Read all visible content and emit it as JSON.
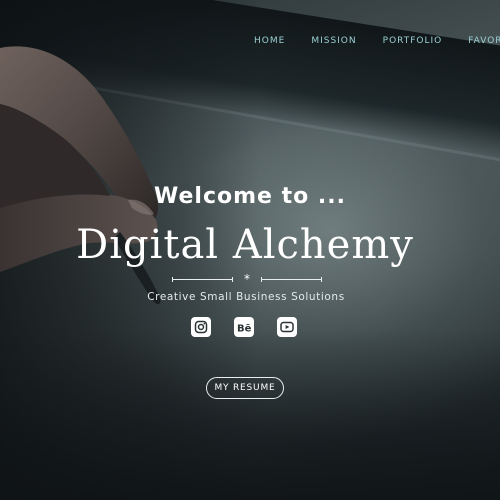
{
  "nav": {
    "items": [
      {
        "label": "HOME"
      },
      {
        "label": "MISSION"
      },
      {
        "label": "PORTFOLIO"
      },
      {
        "label": "FAVORITE"
      }
    ]
  },
  "hero": {
    "welcome": "Welcome to ...",
    "title": "Digital Alchemy",
    "divider_glyph": "*",
    "tagline": "Creative Small Business Solutions",
    "socials": [
      {
        "icon": "instagram-icon"
      },
      {
        "icon": "behance-icon"
      },
      {
        "icon": "youtube-icon"
      }
    ],
    "cta_label": "MY RESUME"
  },
  "colors": {
    "nav_text": "#9ad0d3",
    "text": "#ffffff",
    "background": "#2a3336"
  }
}
